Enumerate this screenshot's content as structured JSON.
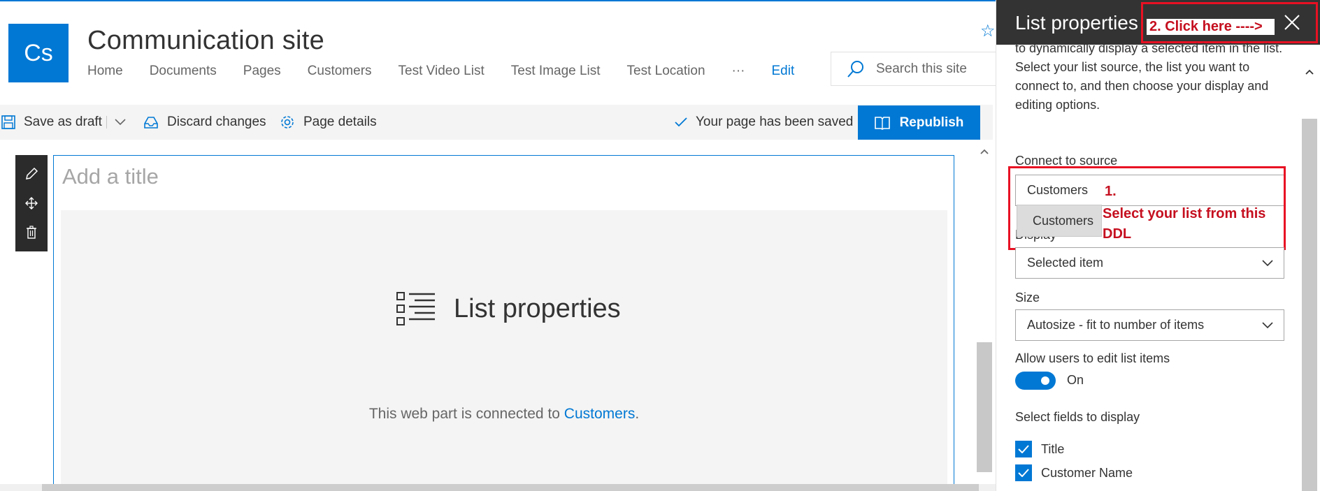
{
  "site": {
    "logo_initials": "Cs",
    "title": "Communication site"
  },
  "nav": {
    "items": [
      "Home",
      "Documents",
      "Pages",
      "Customers",
      "Test Video List",
      "Test Image List",
      "Test Location"
    ],
    "more": "···",
    "edit": "Edit"
  },
  "search": {
    "placeholder": "Search this site"
  },
  "toolbar": {
    "save_draft": "Save as draft",
    "discard": "Discard changes",
    "page_details": "Page details",
    "saved_status": "Your page has been saved",
    "republish": "Republish"
  },
  "canvas": {
    "title_placeholder": "Add a title",
    "webpart_title": "List properties",
    "connected_prefix": "This web part is connected to ",
    "connected_link": "Customers",
    "connected_suffix": "."
  },
  "panel": {
    "title": "List properties",
    "description": "to dynamically display a selected item in the list. Select your list source, the list you want to connect to, and then choose your display and editing options.",
    "connect_label": "Connect to source",
    "connect_value": "Customers",
    "connect_option": "Customers",
    "display_label": "Display",
    "display_value": "Selected item",
    "size_label": "Size",
    "size_value": "Autosize - fit to number of items",
    "allow_edit_label": "Allow users to edit list items",
    "toggle_state": "On",
    "fields_label": "Select fields to display",
    "fields": [
      "Title",
      "Customer Name"
    ]
  },
  "annotations": {
    "step1_number": "1.",
    "step1_text": "Select your list from this DDL",
    "step2_text": "2. Click here ---->"
  },
  "colors": {
    "accent": "#0078d4",
    "annotation": "#e81123",
    "panel_header": "#333333"
  }
}
